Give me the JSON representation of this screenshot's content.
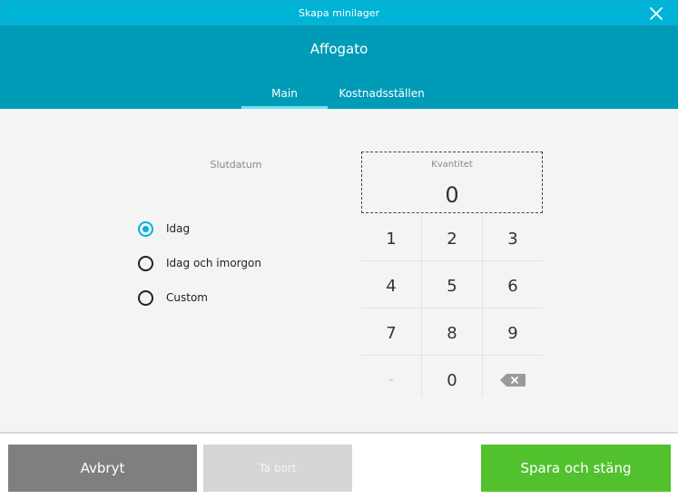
{
  "window": {
    "title": "Skapa minilager",
    "close_icon": "close-x-icon"
  },
  "header": {
    "product": "Affogato",
    "tabs": [
      {
        "label": "Main",
        "active": true
      },
      {
        "label": "Kostnadsställen",
        "active": false
      }
    ]
  },
  "form": {
    "slutdatum_label": "Slutdatum",
    "options": [
      {
        "label": "Idag",
        "checked": true
      },
      {
        "label": "Idag och imorgon",
        "checked": false
      },
      {
        "label": "Custom",
        "checked": false
      }
    ],
    "quantity": {
      "label": "Kvantitet",
      "value": "0"
    }
  },
  "keypad": {
    "keys": [
      "1",
      "2",
      "3",
      "4",
      "5",
      "6",
      "7",
      "8",
      "9",
      "-",
      "0"
    ],
    "backspace_icon": "backspace-icon"
  },
  "footer": {
    "cancel_label": "Avbryt",
    "delete_label": "Ta bort",
    "save_label": "Spara och stäng"
  },
  "colors": {
    "titlebar": "#00b4d8",
    "header": "#009cb7",
    "accent": "#00b4d8",
    "save": "#52c12e",
    "cancel": "#7f7f7f",
    "disabled": "#d6d6d6"
  }
}
